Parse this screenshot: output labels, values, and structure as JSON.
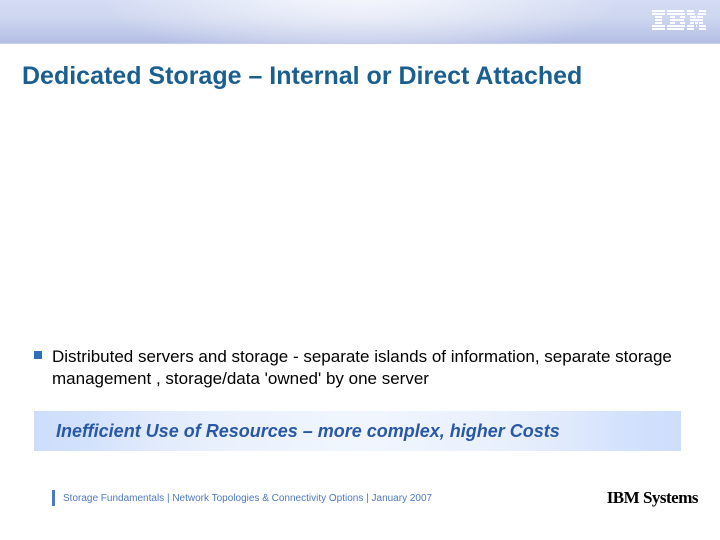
{
  "brand": {
    "logo_label": "IBM",
    "systems_label": "IBM Systems"
  },
  "slide": {
    "title": "Dedicated Storage – Internal or Direct Attached",
    "bullets": [
      "Distributed servers and storage - separate islands of information, separate storage management , storage/data 'owned' by one server"
    ],
    "callout": "Inefficient Use of Resources – more complex, higher Costs"
  },
  "footer": {
    "text": "Storage Fundamentals  | Network Topologies & Connectivity Options  |  January 2007"
  },
  "colors": {
    "title_color": "#1b5f91",
    "accent": "#2d6fb8",
    "callout_text": "#2959a6",
    "footer_text": "#4e79c0"
  }
}
